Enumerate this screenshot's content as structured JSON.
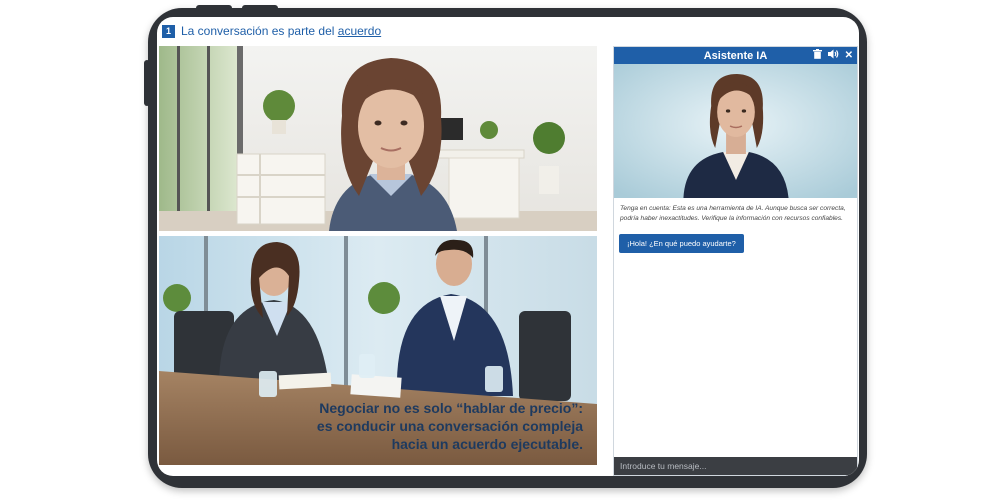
{
  "lesson": {
    "number": "1",
    "title_part1": "La conversación es parte del ",
    "title_part2": "acuerdo"
  },
  "main": {
    "image_caption_lines": [
      "Negociar no es solo “hablar de precio”:",
      "es conducir una conversación compleja",
      "hacia un acuerdo ejecutable."
    ]
  },
  "assistant": {
    "title": "Asistente IA",
    "icons": [
      "trash-icon",
      "speaker-icon",
      "close-icon"
    ],
    "close_label": "✕",
    "disclaimer": "Tenga en cuenta: Esta es una herramienta de IA. Aunque busca ser correcta, podría haber inexactitudes. Verifique la información con recursos confiables.",
    "greeting_button": "¡Hola! ¿En qué puedo ayudarte?",
    "input_placeholder": "Introduce tu mensaje..."
  },
  "colors": {
    "accent": "#1f5fa8",
    "frame": "#2f3237",
    "caption_text": "#1e3a5f"
  }
}
